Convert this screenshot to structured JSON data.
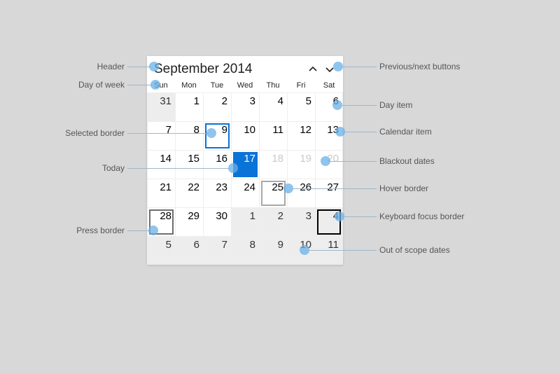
{
  "header": {
    "title": "September 2014"
  },
  "dow": [
    "Sun",
    "Mon",
    "Tue",
    "Wed",
    "Thu",
    "Fri",
    "Sat"
  ],
  "days": [
    {
      "n": "31",
      "cls": "out"
    },
    {
      "n": "1"
    },
    {
      "n": "2"
    },
    {
      "n": "3"
    },
    {
      "n": "4"
    },
    {
      "n": "5"
    },
    {
      "n": "6"
    },
    {
      "n": "7"
    },
    {
      "n": "8"
    },
    {
      "n": "9",
      "cls": "selected"
    },
    {
      "n": "10"
    },
    {
      "n": "11"
    },
    {
      "n": "12"
    },
    {
      "n": "13"
    },
    {
      "n": "14"
    },
    {
      "n": "15"
    },
    {
      "n": "16"
    },
    {
      "n": "17",
      "cls": "today"
    },
    {
      "n": "18",
      "cls": "blackout"
    },
    {
      "n": "19",
      "cls": "blackout"
    },
    {
      "n": "20",
      "cls": "blackout"
    },
    {
      "n": "21"
    },
    {
      "n": "22"
    },
    {
      "n": "23"
    },
    {
      "n": "24"
    },
    {
      "n": "25",
      "cls": "hover"
    },
    {
      "n": "26"
    },
    {
      "n": "27"
    },
    {
      "n": "28",
      "cls": "press"
    },
    {
      "n": "29"
    },
    {
      "n": "30"
    },
    {
      "n": "1",
      "cls": "out"
    },
    {
      "n": "2",
      "cls": "out"
    },
    {
      "n": "3",
      "cls": "out"
    },
    {
      "n": "4",
      "cls": "out focus"
    },
    {
      "n": "5",
      "cls": "out"
    },
    {
      "n": "6",
      "cls": "out"
    },
    {
      "n": "7",
      "cls": "out"
    },
    {
      "n": "8",
      "cls": "out"
    },
    {
      "n": "9",
      "cls": "out"
    },
    {
      "n": "10",
      "cls": "out"
    },
    {
      "n": "11",
      "cls": "out"
    }
  ],
  "labels": {
    "header": "Header",
    "dow": "Day of week",
    "selected": "Selected border",
    "today": "Today",
    "press": "Press border",
    "prevnext": "Previous/next buttons",
    "dayitem": "Day item",
    "calitem": "Calendar item",
    "blackout": "Blackout dates",
    "hover": "Hover border",
    "focus": "Keyboard focus border",
    "outofscope": "Out of scope dates"
  }
}
